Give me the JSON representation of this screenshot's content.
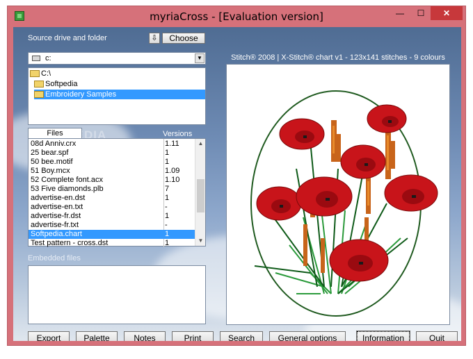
{
  "window": {
    "title": "myriaCross - [Evaluation version]",
    "min_glyph": "—",
    "max_glyph": "☐",
    "close_glyph": "✕"
  },
  "source": {
    "label": "Source drive and folder",
    "down_glyph": "⇩",
    "choose_label": "Choose",
    "drive_value": "c:",
    "dropdown_glyph": "▼"
  },
  "tree": {
    "items": [
      {
        "label": "C:\\"
      },
      {
        "label": "Softpedia"
      },
      {
        "label": "Embroidery Samples"
      }
    ]
  },
  "files": {
    "tab_label": "Files",
    "versions_label": "Versions",
    "scroll_up": "▲",
    "scroll_down": "▼",
    "rows": [
      {
        "name": "08d Anniv.crx",
        "version": "1.11"
      },
      {
        "name": "25 bear.spf",
        "version": "1"
      },
      {
        "name": "50 bee.motif",
        "version": "1"
      },
      {
        "name": "51 Boy.mcx",
        "version": "1.09"
      },
      {
        "name": "52 Complete font.acx",
        "version": "1.10"
      },
      {
        "name": "53 Five diamonds.plb",
        "version": "7"
      },
      {
        "name": "advertise-en.dst",
        "version": "1"
      },
      {
        "name": "advertise-en.txt",
        "version": "-"
      },
      {
        "name": "advertise-fr.dst",
        "version": "1"
      },
      {
        "name": "advertise-fr.txt",
        "version": "-"
      },
      {
        "name": "Softpedia.chart",
        "version": "1"
      },
      {
        "name": "Test pattern - cross.dst",
        "version": "1"
      }
    ]
  },
  "watermark": "SOFTPEDIA",
  "embedded": {
    "label": "Embedded files"
  },
  "chart": {
    "title": "Stitch® 2008 | X-Stitch® chart v1 - 123x141 stitches - 9 colours"
  },
  "buttons": {
    "export": "Export",
    "palette": "Palette",
    "notes": "Notes",
    "print": "Print",
    "search": "Search",
    "general": "General options",
    "information": "Information",
    "quit": "Quit"
  },
  "colors": {
    "accent_selection": "#3399ff",
    "titlebar": "#d6717a",
    "close_button": "#c7383b",
    "poppy_red": "#c8141a",
    "stem_green": "#1f7a2a",
    "wheat": "#c8641a"
  }
}
